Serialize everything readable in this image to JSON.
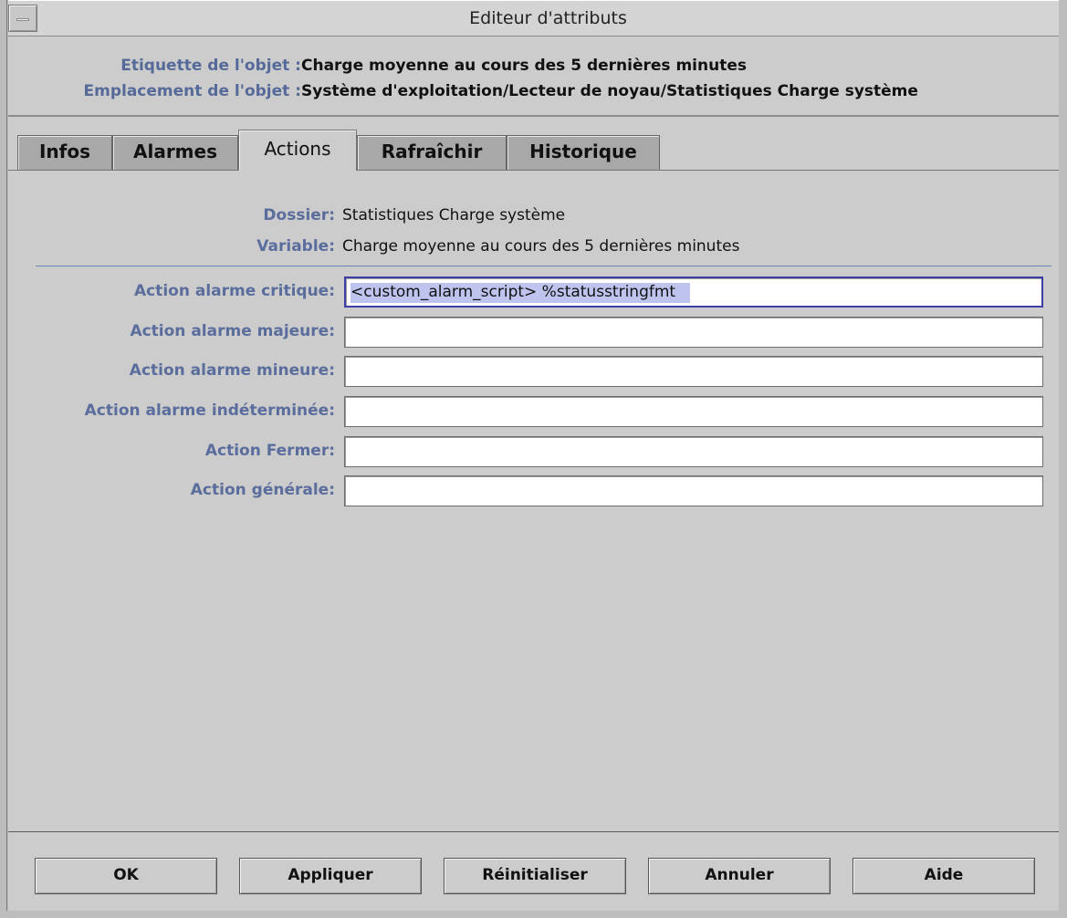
{
  "window": {
    "title": "Editeur d'attributs"
  },
  "object_info": {
    "label_caption": "Etiquette de l'objet :",
    "label_value": "Charge moyenne au cours des 5 dernières minutes",
    "location_caption": "Emplacement de l'objet :",
    "location_value": "Système d'exploitation/Lecteur de noyau/Statistiques Charge système"
  },
  "tabs": [
    {
      "label": "Infos",
      "active": false
    },
    {
      "label": "Alarmes",
      "active": false
    },
    {
      "label": "Actions",
      "active": true
    },
    {
      "label": "Rafraîchir",
      "active": false
    },
    {
      "label": "Historique",
      "active": false
    }
  ],
  "actions_panel": {
    "folder_label": "Dossier:",
    "folder_value": "Statistiques Charge système",
    "variable_label": "Variable:",
    "variable_value": "Charge moyenne au cours des 5 dernières minutes",
    "fields": [
      {
        "label": "Action alarme critique:",
        "value": "<custom_alarm_script> %statusstringfmt"
      },
      {
        "label": "Action alarme majeure:",
        "value": ""
      },
      {
        "label": "Action alarme mineure:",
        "value": ""
      },
      {
        "label": "Action alarme indéterminée:",
        "value": ""
      },
      {
        "label": "Action Fermer:",
        "value": ""
      },
      {
        "label": "Action générale:",
        "value": ""
      }
    ]
  },
  "buttons": {
    "ok": "OK",
    "apply": "Appliquer",
    "reset": "Réinitialiser",
    "cancel": "Annuler",
    "help": "Aide"
  },
  "colors": {
    "label_blue": "#5a6d9c",
    "focus_border": "#3b3fa6",
    "selection": "#bfc4ef"
  }
}
